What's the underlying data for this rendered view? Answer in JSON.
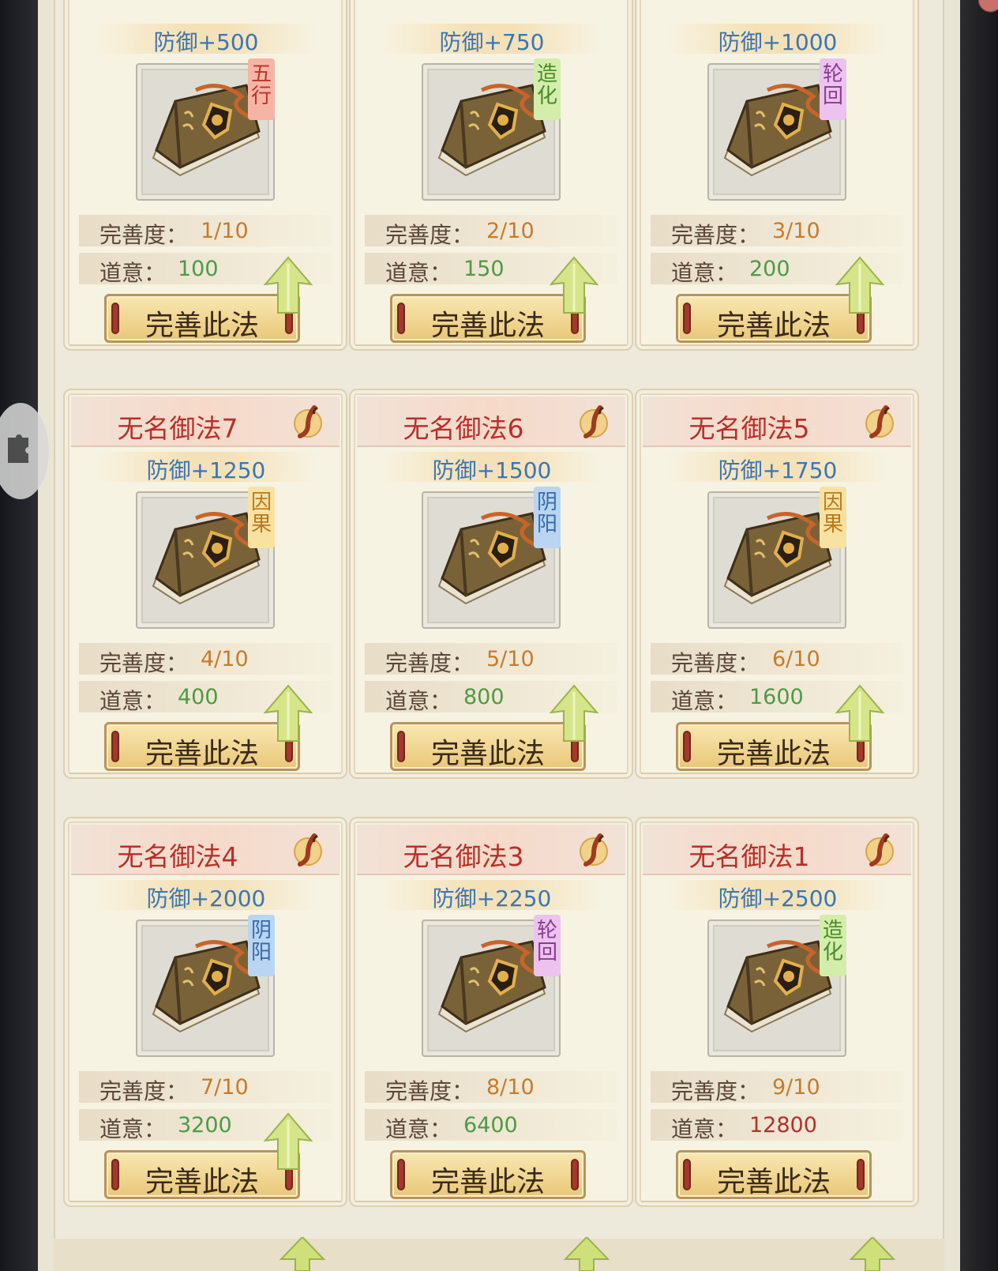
{
  "button_label": "完善此法",
  "completion_label": "完善度：",
  "daoyi_label": "道意：",
  "top_cards": [
    {
      "defense": "防御+500",
      "tag": "五行",
      "tag_color": "red",
      "completion": "1/10",
      "daoyi": "100"
    },
    {
      "defense": "防御+750",
      "tag": "造化",
      "tag_color": "green",
      "completion": "2/10",
      "daoyi": "150"
    },
    {
      "defense": "防御+1000",
      "tag": "轮回",
      "tag_color": "purple",
      "completion": "3/10",
      "daoyi": "200"
    }
  ],
  "cards": [
    {
      "name": "无名御法7",
      "defense": "防御+1250",
      "tag": "因果",
      "tag_color": "yellow",
      "completion": "4/10",
      "daoyi": "400"
    },
    {
      "name": "无名御法6",
      "defense": "防御+1500",
      "tag": "阴阳",
      "tag_color": "blue",
      "completion": "5/10",
      "daoyi": "800"
    },
    {
      "name": "无名御法5",
      "defense": "防御+1750",
      "tag": "因果",
      "tag_color": "yellow",
      "completion": "6/10",
      "daoyi": "1600"
    },
    {
      "name": "无名御法4",
      "defense": "防御+2000",
      "tag": "阴阳",
      "tag_color": "blue",
      "completion": "7/10",
      "daoyi": "3200"
    },
    {
      "name": "无名御法3",
      "defense": "防御+2250",
      "tag": "轮回",
      "tag_color": "purple",
      "completion": "8/10",
      "daoyi": "6400"
    },
    {
      "name": "无名御法1",
      "defense": "防御+2500",
      "tag": "造化",
      "tag_color": "green",
      "completion": "9/10",
      "daoyi": "12800"
    }
  ],
  "colors": {
    "card_bg": "#f6f3e2",
    "name_red": "#b6302a",
    "defense_blue": "#3b76b0",
    "daoyi_green": "#4e9a45",
    "daoyi_red": "#b3302a",
    "completion_orange": "#c97a2a"
  }
}
